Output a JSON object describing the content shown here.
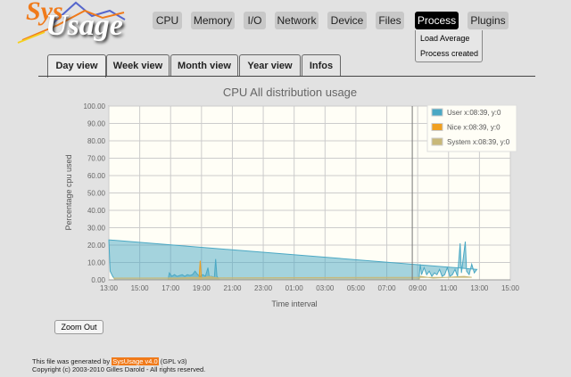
{
  "logo": {
    "text_top": "Sys",
    "text_bottom": "Usage"
  },
  "menu": [
    {
      "label": "CPU"
    },
    {
      "label": "Memory"
    },
    {
      "label": "I/O"
    },
    {
      "label": "Network"
    },
    {
      "label": "Device"
    },
    {
      "label": "Files"
    },
    {
      "label": "Process",
      "active": true
    },
    {
      "label": "Plugins"
    }
  ],
  "dropdown": [
    "Load Average",
    "Process created"
  ],
  "tabs": [
    {
      "label": "Day view",
      "active": true
    },
    {
      "label": "Week view"
    },
    {
      "label": "Month view"
    },
    {
      "label": "Year view"
    },
    {
      "label": "Infos"
    }
  ],
  "zoom_out": "Zoom Out",
  "footer": {
    "line1_pre": "This file was generated by",
    "link": "SysUsage v4.0",
    "line1_post": "(GPL v3)",
    "line2": "Copyright (c) 2003-2010 Gilles Darold - All rights reserved."
  },
  "chart_data": {
    "type": "area",
    "title": "CPU All distribution usage",
    "xlabel": "Time interval",
    "ylabel": "Percentage cpu used",
    "ylim": [
      0,
      100
    ],
    "yticks": [
      "0.00",
      "10.00",
      "20.00",
      "30.00",
      "40.00",
      "50.00",
      "60.00",
      "70.00",
      "80.00",
      "90.00",
      "100.00"
    ],
    "xticks": [
      "13:00",
      "15:00",
      "17:00",
      "19:00",
      "21:00",
      "23:00",
      "01:00",
      "03:00",
      "05:00",
      "07:00",
      "09:00",
      "11:00",
      "13:00",
      "15:00"
    ],
    "grid": true,
    "legend_position": "top-right",
    "crosshair": "08:39",
    "series": [
      {
        "name": "User",
        "legend": "User x:08:39, y:0",
        "color": "#4aa8c4",
        "x": [
          "16:50",
          "16:55",
          "17:05",
          "17:15",
          "17:25",
          "17:35",
          "17:45",
          "17:55",
          "18:05",
          "18:15",
          "18:25",
          "18:35",
          "18:45",
          "18:55",
          "19:05",
          "19:15",
          "19:25",
          "19:30",
          "19:40",
          "19:50",
          "19:55",
          "20:00",
          "20:05",
          "20:10",
          "09:05",
          "09:10",
          "09:15",
          "09:25",
          "09:35",
          "09:45",
          "09:55",
          "10:05",
          "10:15",
          "10:25",
          "10:35",
          "10:45",
          "10:55",
          "11:05",
          "11:15",
          "11:25",
          "11:35",
          "11:45",
          "11:50",
          "11:55",
          "12:05",
          "12:10",
          "12:20",
          "12:30",
          "12:40",
          "12:50",
          "13:00",
          "13:05",
          "13:15",
          "13:25"
        ],
        "values": [
          0,
          4,
          2,
          3,
          2,
          2.5,
          3,
          2,
          3,
          2.5,
          3,
          5,
          3,
          2,
          3,
          2,
          7,
          2,
          2,
          1.5,
          12,
          2,
          1,
          0,
          0,
          9,
          3,
          7,
          3,
          5,
          2,
          4,
          3,
          6,
          2,
          3,
          7,
          2,
          3,
          6,
          2,
          21,
          4,
          10,
          22,
          5,
          3,
          9,
          4,
          6,
          23,
          5,
          2,
          0
        ]
      },
      {
        "name": "Nice",
        "legend": "Nice x:08:39, y:0",
        "color": "#f0a020",
        "x": [
          "18:50",
          "18:55",
          "19:00"
        ],
        "values": [
          0,
          11,
          0
        ]
      },
      {
        "name": "System",
        "legend": "System x:08:39, y:0",
        "color": "#c8b878",
        "x": [
          "16:50",
          "16:55",
          "17:30",
          "18:30",
          "19:00",
          "19:30",
          "20:05",
          "20:10",
          "09:05",
          "09:10",
          "10:00",
          "11:00",
          "12:00",
          "12:30",
          "13:20",
          "13:25"
        ],
        "values": [
          0,
          1,
          1,
          1.5,
          1,
          2,
          1,
          0,
          0,
          2,
          1,
          1.5,
          2,
          1.5,
          1,
          0
        ]
      }
    ]
  }
}
